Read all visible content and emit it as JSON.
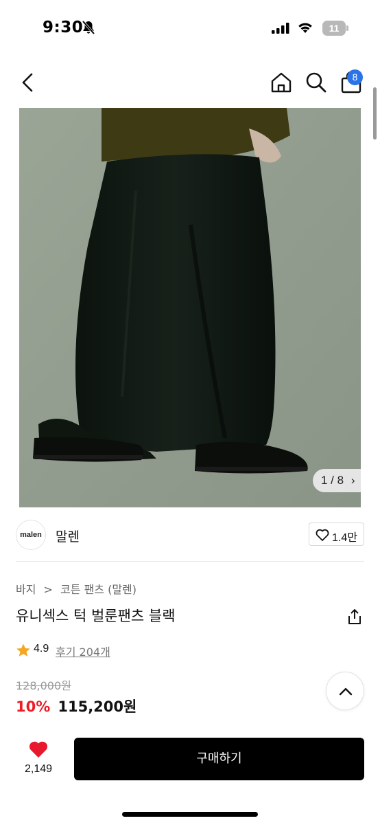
{
  "status_bar": {
    "time": "9:30",
    "battery_level": "11",
    "icons": [
      "bell-slash-icon",
      "signal-icon",
      "wifi-icon",
      "battery-icon"
    ]
  },
  "nav": {
    "icons": [
      "back-arrow-icon",
      "home-icon",
      "search-icon",
      "shopping-bag-icon"
    ],
    "cart_count": "8"
  },
  "gallery": {
    "current": "1",
    "total": "8",
    "counter_text": "1 / 8"
  },
  "brand": {
    "logo_text": "malen",
    "name": "말렌",
    "like_count": "1.4만"
  },
  "breadcrumb": {
    "items": [
      "바지",
      "코튼 팬츠 (말렌)"
    ],
    "separator": ">"
  },
  "product": {
    "title": "유니섹스 턱 벌룬팬츠 블랙",
    "rating": "4.9",
    "review_text": "후기 204개",
    "original_price": "128,000원",
    "discount_rate": "10%",
    "sale_price": "115,200원"
  },
  "bottom_bar": {
    "wish_count": "2,149",
    "buy_label": "구매하기"
  },
  "colors": {
    "accent_blue": "#2a74e8",
    "discount_red": "#ee1c25",
    "heart_red": "#e8192c",
    "star_yellow": "#f5a623",
    "buy_button": "#000000"
  }
}
